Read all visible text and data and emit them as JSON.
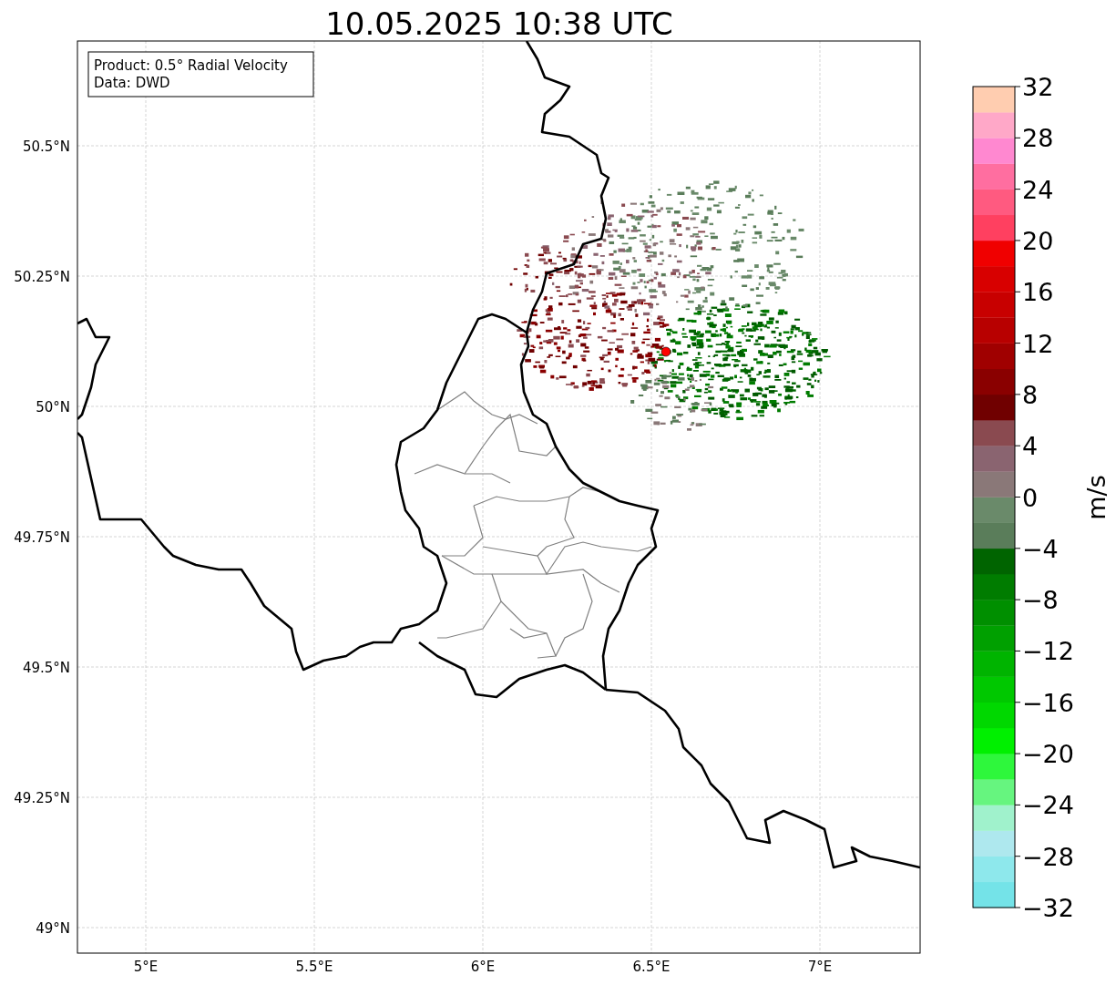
{
  "title": "10.05.2025 10:38 UTC",
  "info_box": [
    "Product: 0.5° Radial Velocity",
    "Data: DWD"
  ],
  "map": {
    "lat_labels": [
      "50.5°N",
      "50.25°N",
      "50°N",
      "49.75°N",
      "49.5°N",
      "49.25°N",
      "49°N"
    ],
    "lon_labels": [
      "5°E",
      "5.5°E",
      "6°E",
      "6.5°E",
      "7°E"
    ]
  },
  "colorbar": {
    "label": "m/s",
    "ticks": [
      "32",
      "28",
      "24",
      "20",
      "16",
      "12",
      "8",
      "4",
      "0",
      "−4",
      "−8",
      "−12",
      "−16",
      "−20",
      "−24",
      "−28",
      "−32"
    ],
    "segments": [
      {
        "color": "#74e3e8"
      },
      {
        "color": "#8ee8ec"
      },
      {
        "color": "#aee8ee"
      },
      {
        "color": "#a0f2cc"
      },
      {
        "color": "#66f57f"
      },
      {
        "color": "#2ef73c"
      },
      {
        "color": "#00f000"
      },
      {
        "color": "#00d800"
      },
      {
        "color": "#00c800"
      },
      {
        "color": "#00b400"
      },
      {
        "color": "#00a000"
      },
      {
        "color": "#008f00"
      },
      {
        "color": "#007c00"
      },
      {
        "color": "#006400"
      },
      {
        "color": "#5a7d5a"
      },
      {
        "color": "#6a8a6a"
      },
      {
        "color": "#8a7878"
      },
      {
        "color": "#8a6470"
      },
      {
        "color": "#8a4a50"
      },
      {
        "color": "#700000"
      },
      {
        "color": "#8a0000"
      },
      {
        "color": "#a00000"
      },
      {
        "color": "#b80000"
      },
      {
        "color": "#c80000"
      },
      {
        "color": "#d80000"
      },
      {
        "color": "#f00000"
      },
      {
        "color": "#ff4060"
      },
      {
        "color": "#ff5a80"
      },
      {
        "color": "#ff6ea0"
      },
      {
        "color": "#ff88d0"
      },
      {
        "color": "#ffa8c8"
      },
      {
        "color": "#ffcdb0"
      }
    ]
  }
}
